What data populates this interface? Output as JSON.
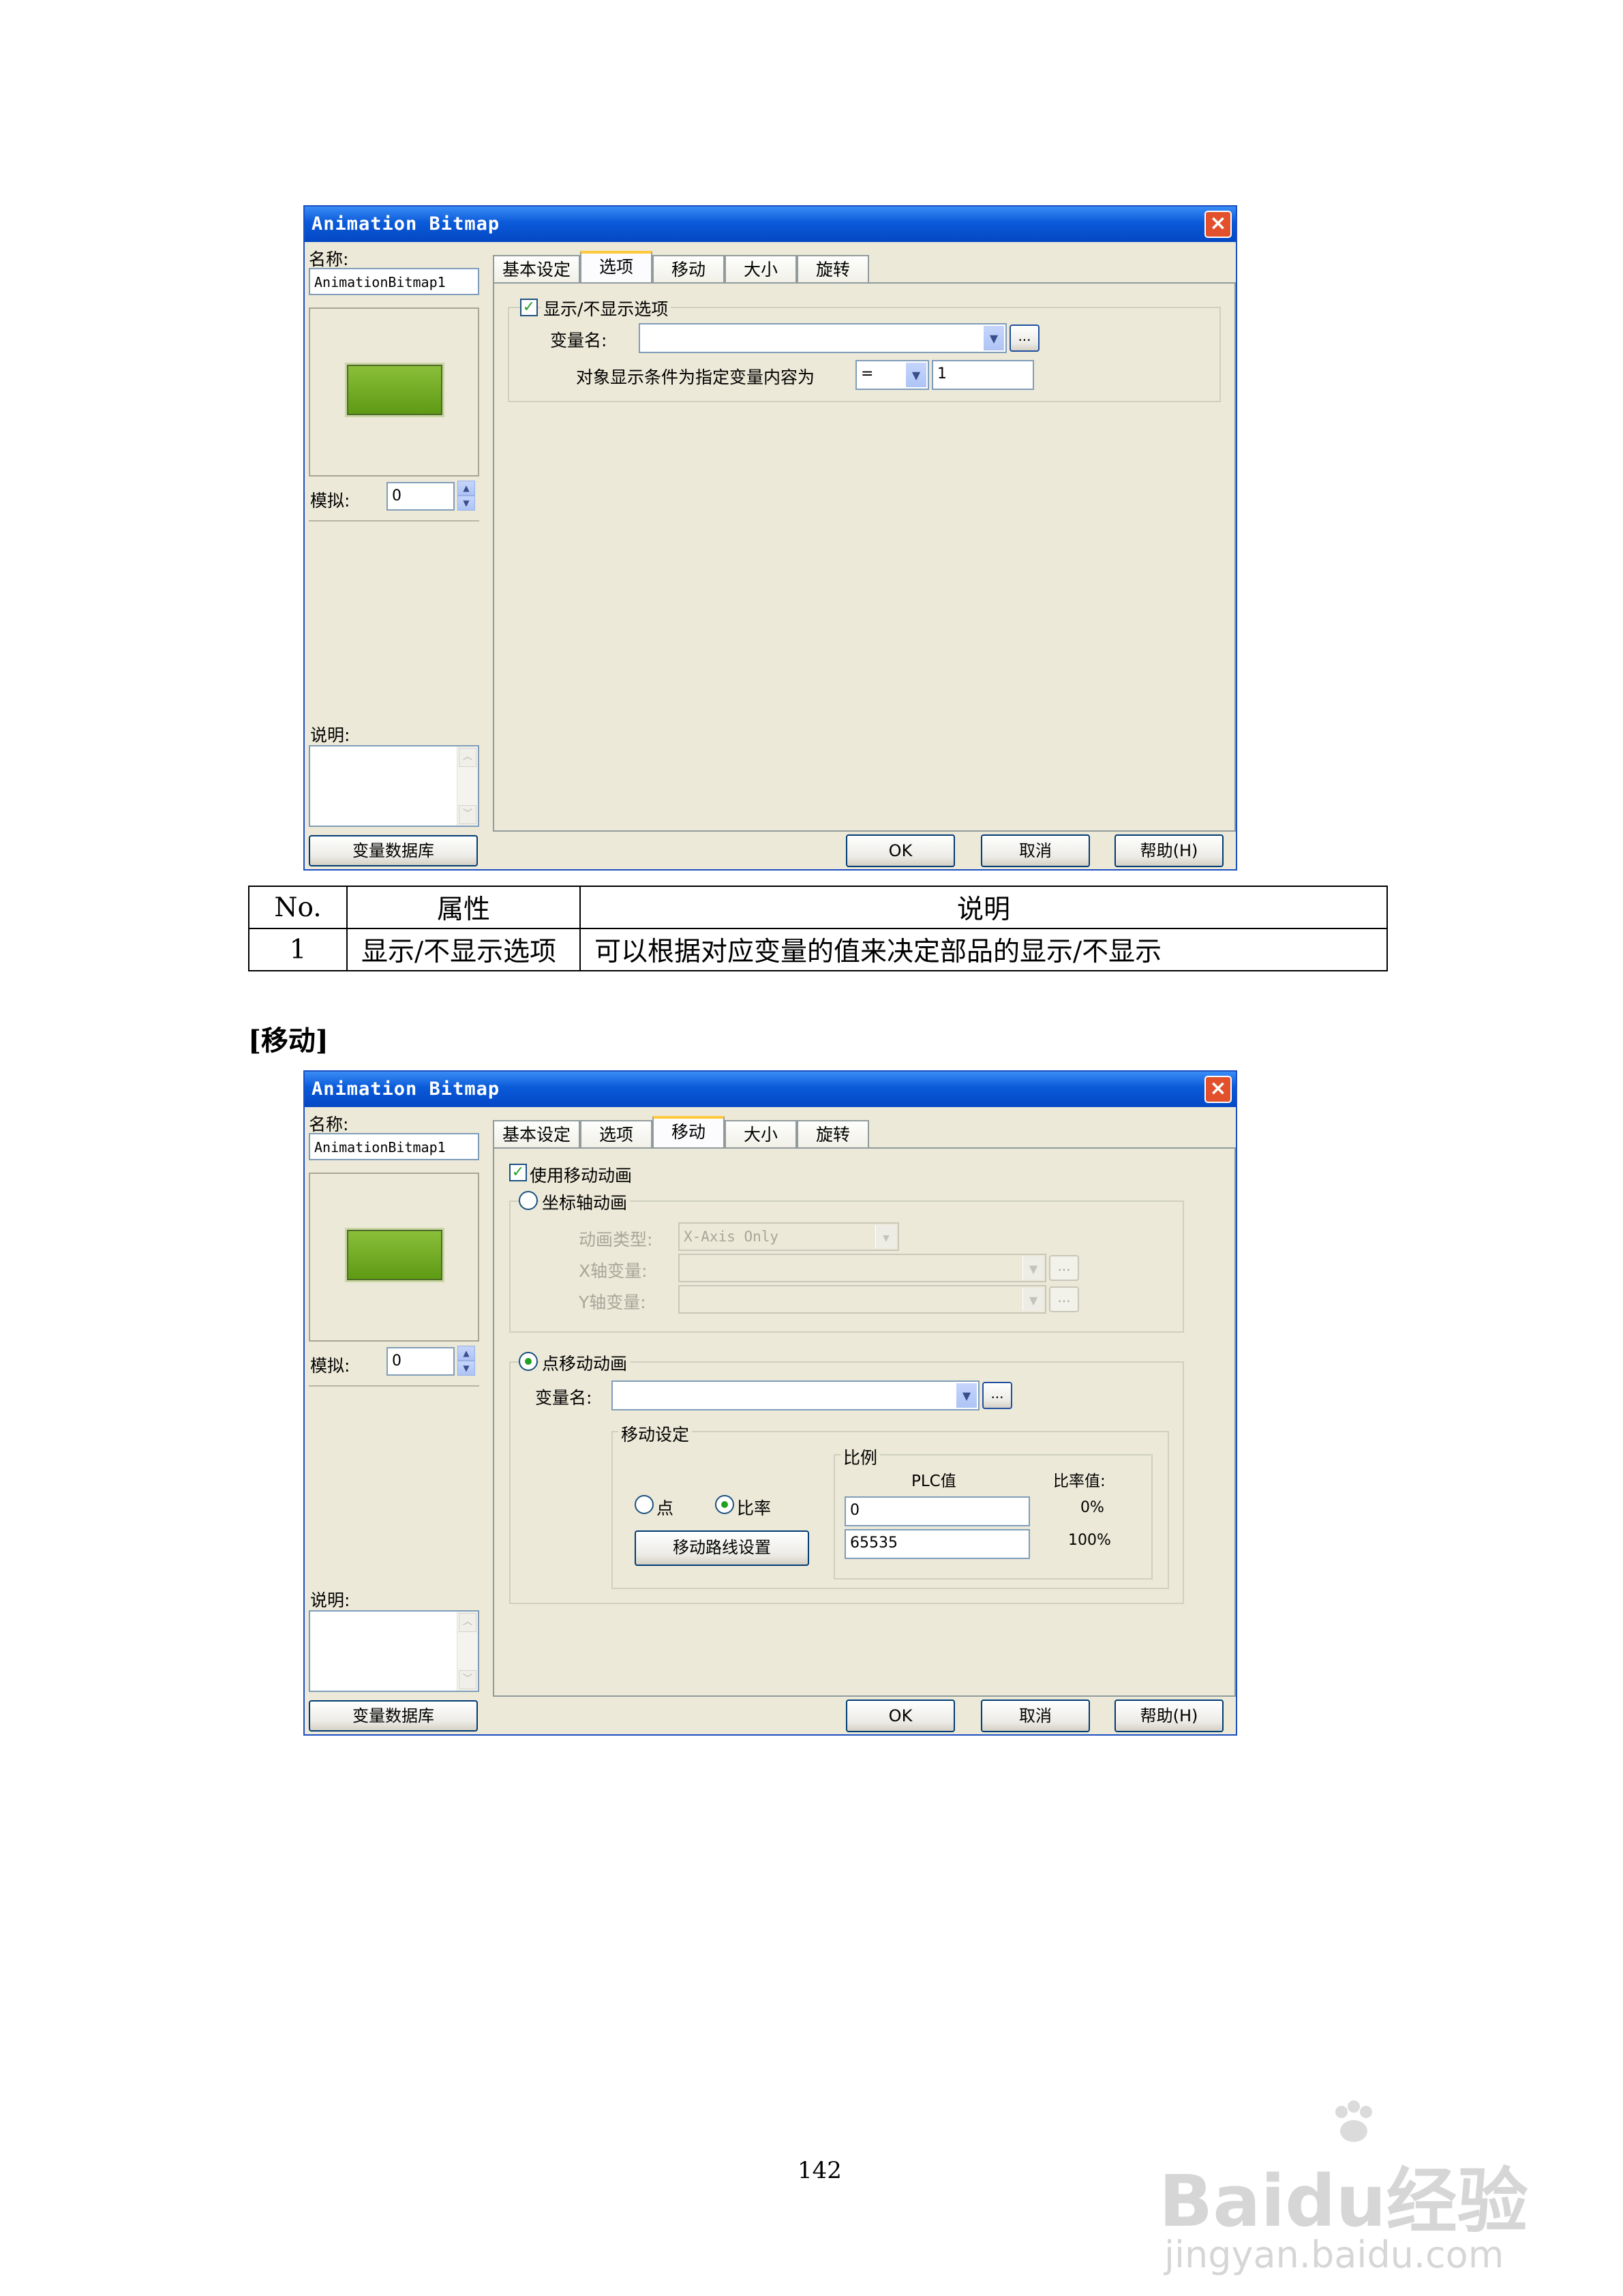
{
  "dialog1": {
    "title": "Animation Bitmap",
    "name_label": "名称:",
    "name_value": "AnimationBitmap1",
    "sim_label": "模拟:",
    "sim_value": "0",
    "desc_label": "说明:",
    "db_button": "变量数据库",
    "tabs": [
      "基本设定",
      "选项",
      "移动",
      "大小",
      "旋转"
    ],
    "active_tab": "选项",
    "show_hide_label": "显示/不显示选项",
    "show_hide_checked": true,
    "var_label": "变量名:",
    "var_value": "",
    "cond_label": "对象显示条件为指定变量内容为",
    "cond_op": "=",
    "cond_value": "1",
    "ok": "OK",
    "cancel": "取消",
    "help": "帮助(H)",
    "ellipsis": "..."
  },
  "table": {
    "headers": [
      "No.",
      "属性",
      "说明"
    ],
    "rows": [
      [
        "1",
        "显示/不显示选项",
        "可以根据对应变量的值来决定部品的显示/不显示"
      ]
    ]
  },
  "section_heading": "[移动]",
  "dialog2": {
    "title": "Animation Bitmap",
    "name_label": "名称:",
    "name_value": "AnimationBitmap1",
    "sim_label": "模拟:",
    "sim_value": "0",
    "desc_label": "说明:",
    "db_button": "变量数据库",
    "tabs": [
      "基本设定",
      "选项",
      "移动",
      "大小",
      "旋转"
    ],
    "active_tab": "移动",
    "use_move_label": "使用移动动画",
    "use_move_checked": true,
    "axis_anim_label": "坐标轴动画",
    "axis_anim_selected": false,
    "anim_type_label": "动画类型:",
    "anim_type_value": "X-Axis Only",
    "x_var_label": "X轴变量:",
    "y_var_label": "Y轴变量:",
    "point_anim_label": "点移动动画",
    "point_anim_selected": true,
    "var_label": "变量名:",
    "move_settings_label": "移动设定",
    "point_label": "点",
    "point_selected": false,
    "ratio_label": "比率",
    "ratio_selected": true,
    "path_button": "移动路线设置",
    "scale_label": "比例",
    "plc_label": "PLC值",
    "ratio_value_label": "比率值:",
    "plc_min": "0",
    "plc_max": "65535",
    "ratio_min": "0%",
    "ratio_max": "100%",
    "ok": "OK",
    "cancel": "取消",
    "help": "帮助(H)",
    "ellipsis": "..."
  },
  "page_number": "142",
  "watermark": {
    "line1": "Baidu经验",
    "line2": "jingyan.baidu.com"
  }
}
